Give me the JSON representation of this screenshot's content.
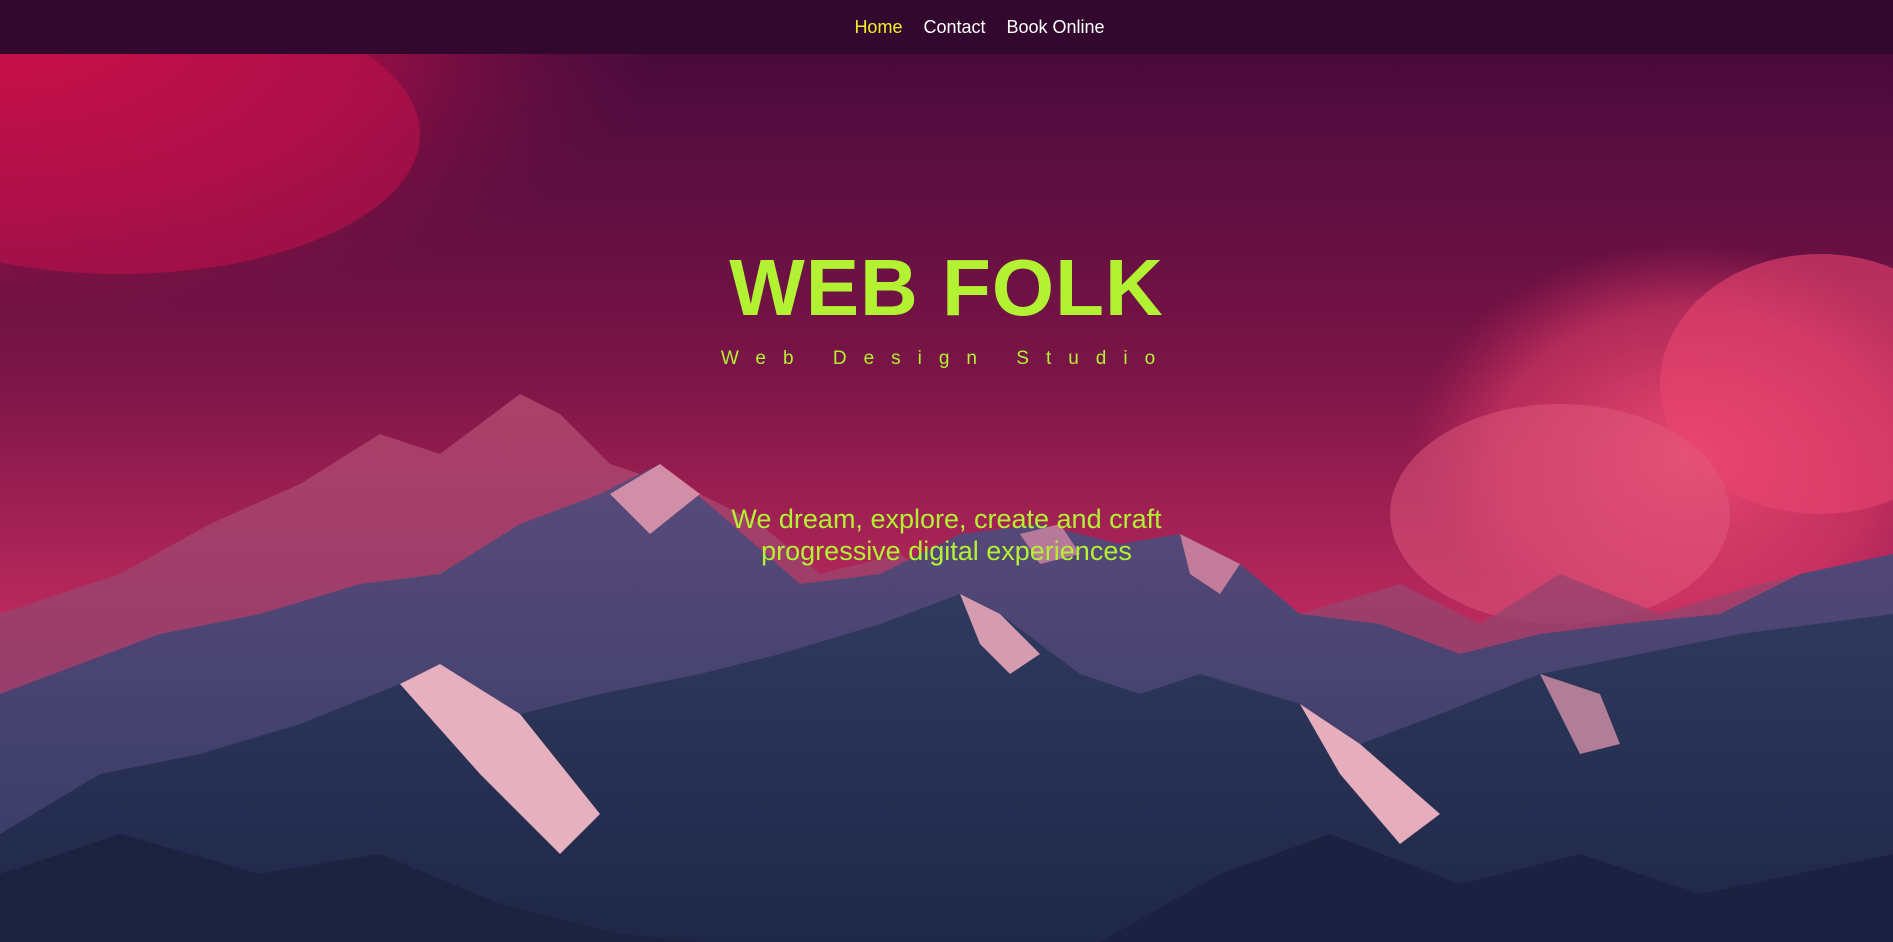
{
  "nav": {
    "items": [
      {
        "label": "Home",
        "active": true
      },
      {
        "label": "Contact",
        "active": false
      },
      {
        "label": "Book Online",
        "active": false
      }
    ]
  },
  "hero": {
    "title": "WEB FOLK",
    "subtitle": "Web Design Studio",
    "tagline_line1": "We dream, explore, create and craft",
    "tagline_line2": "progressive digital experiences",
    "background_image": "mountains-under-magenta-sky"
  },
  "colors": {
    "nav_bg": "#33082f",
    "nav_text": "#ffffff",
    "nav_active": "#f5ee2a",
    "accent": "#b2f233",
    "sky_top": "#3d0835",
    "sky_cloud": "#d2124f",
    "mountain_dark": "#2a3155"
  }
}
